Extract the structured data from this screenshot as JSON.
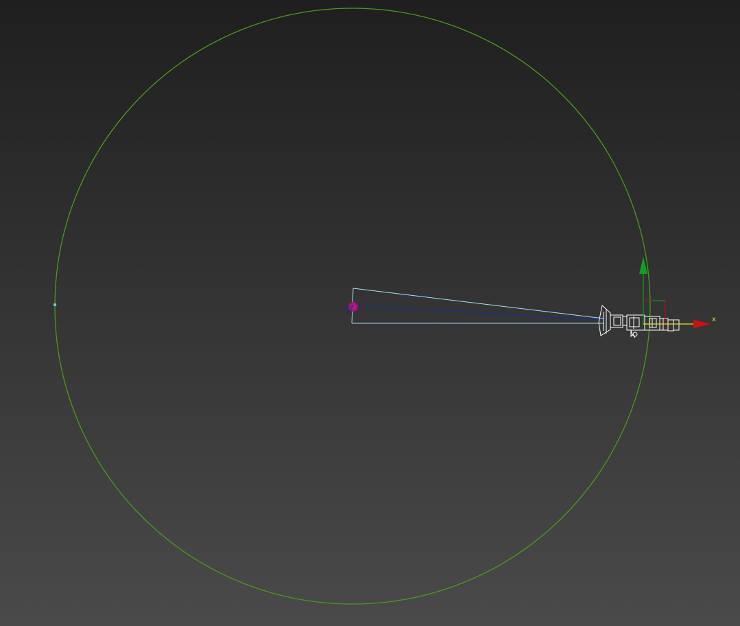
{
  "viewport": {
    "background_top": "#1f1f1f",
    "background_bottom": "#4a4a4a"
  },
  "scene": {
    "path_circle_color": "#4a9a1a",
    "camera_frustum_color": "#a8e4f0",
    "target_line_color": "#1a2e8c",
    "target_marker_color": "#a0107a",
    "camera_wire_color": "#ffffff",
    "vertex_color": "#6ad0d8"
  },
  "gizmo": {
    "x_label": "x",
    "x_color": "#d01010",
    "y_color": "#10a020",
    "x_axis_line_color": "#e8e020",
    "z_corner_color": "#c01010"
  },
  "icons": {
    "camera": "camera-wireframe-icon",
    "target": "camera-target-icon",
    "cursor": "move-cursor-icon"
  }
}
